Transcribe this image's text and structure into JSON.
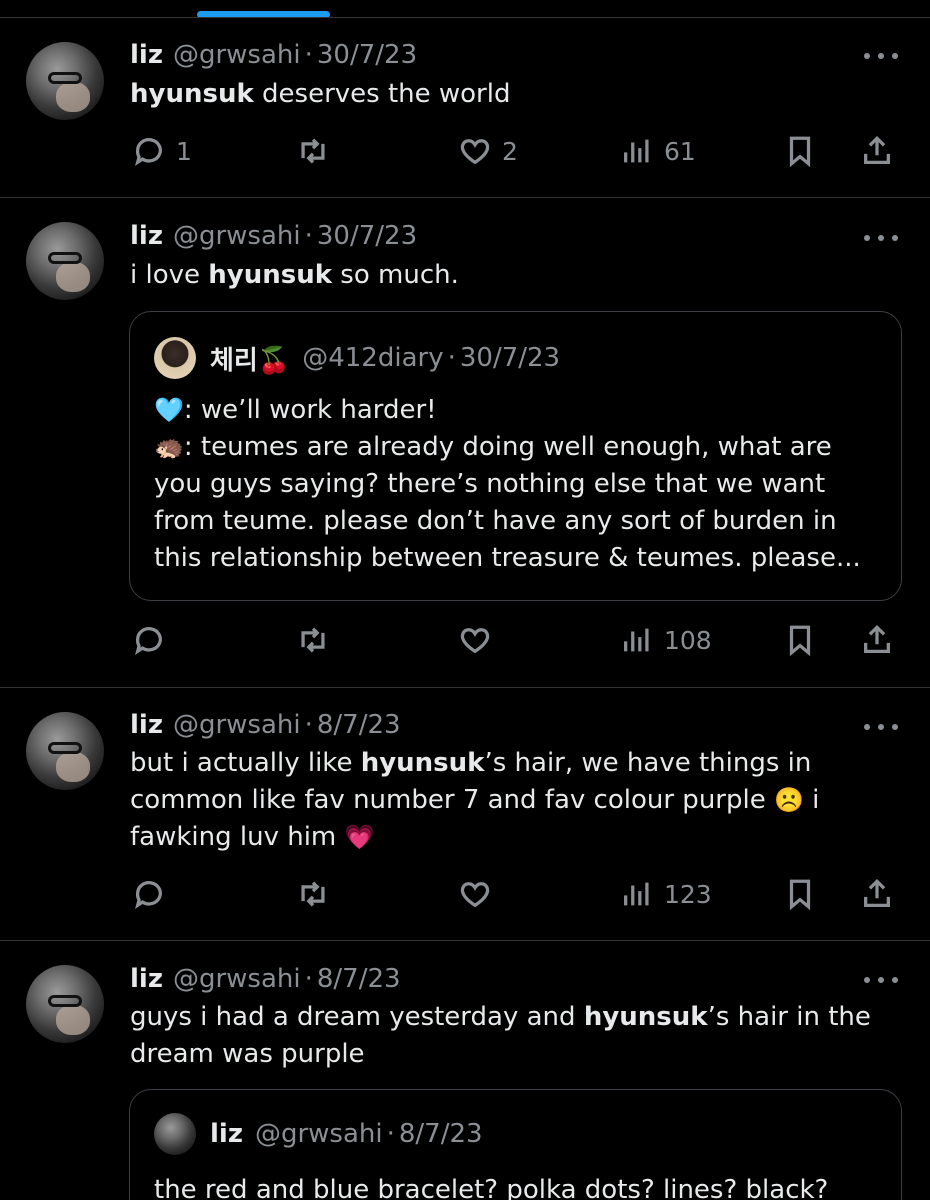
{
  "tweets": [
    {
      "name": "liz",
      "handle": "@grwsahi",
      "date": "30/7/23",
      "text_bold": "hyunsuk",
      "text_after": " deserves the world",
      "replies": "1",
      "likes": "2",
      "views": "61"
    },
    {
      "name": "liz",
      "handle": "@grwsahi",
      "date": "30/7/23",
      "text_before": "i love ",
      "text_bold": "hyunsuk",
      "text_after": " so much.",
      "quote": {
        "name": "체리🍒",
        "handle": "@412diary",
        "date": "30/7/23",
        "line1_emoji": "🩵",
        "line1": ": we’ll work harder!",
        "line2_emoji": "🦔",
        "line2": ": teumes are already doing well enough, what are you guys saying? there’s nothing else that we want from teume. please don’t have any sort of burden in this relationship between treasure & teumes. please..."
      },
      "views": "108"
    },
    {
      "name": "liz",
      "handle": "@grwsahi",
      "date": "8/7/23",
      "text_before": "but i actually like ",
      "text_bold": "hyunsuk",
      "text_after": "’s hair, we have things in common like fav number 7 and fav colour purple ",
      "emoji1": "☹️",
      "text_after2": " i fawking luv him ",
      "emoji2": "💗",
      "views": "123"
    },
    {
      "name": "liz",
      "handle": "@grwsahi",
      "date": "8/7/23",
      "text_before": "guys i had a dream yesterday and ",
      "text_bold": "hyunsuk",
      "text_after": "’s hair in the dream was purple",
      "quote": {
        "name": "liz",
        "handle": "@grwsahi",
        "date": "8/7/23",
        "text": "the red and blue bracelet? polka dots? lines? black?"
      }
    }
  ],
  "dot_separator": "·",
  "icons": [
    "reply-icon",
    "retweet-icon",
    "like-icon",
    "views-icon",
    "bookmark-icon",
    "share-icon",
    "more-icon"
  ],
  "colors": {
    "background": "#000000",
    "text": "#e7e9ea",
    "muted": "#8b8f94",
    "divider": "#2f3336",
    "accent": "#1d9bf0"
  }
}
